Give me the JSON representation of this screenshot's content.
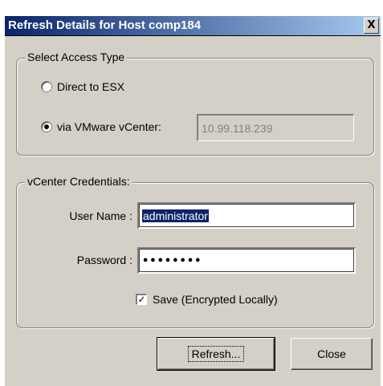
{
  "window": {
    "title": "Refresh Details for Host comp184",
    "close_glyph": "X"
  },
  "access_type": {
    "legend": "Select Access Type",
    "direct_label": "Direct to ESX",
    "direct_checked": false,
    "vcenter_label": "via VMware vCenter:",
    "vcenter_checked": true,
    "vcenter_address": "10.99.118.239"
  },
  "credentials": {
    "legend": "vCenter Credentials:",
    "username_label": "User Name :",
    "username_value": "administrator",
    "password_label": "Password :",
    "password_mask": "••••••••",
    "save_label": "Save (Encrypted Locally)",
    "save_checked": true,
    "save_check_glyph": "✓"
  },
  "buttons": {
    "refresh": "Refresh...",
    "close": "Close"
  },
  "icons": {
    "close": "close-icon",
    "radio": "radio-icon",
    "checkbox": "checkbox-icon"
  },
  "colors": {
    "title_start": "#0a246a",
    "title_end": "#a6caf0",
    "face": "#d4d0c8",
    "selection": "#0a246a"
  }
}
